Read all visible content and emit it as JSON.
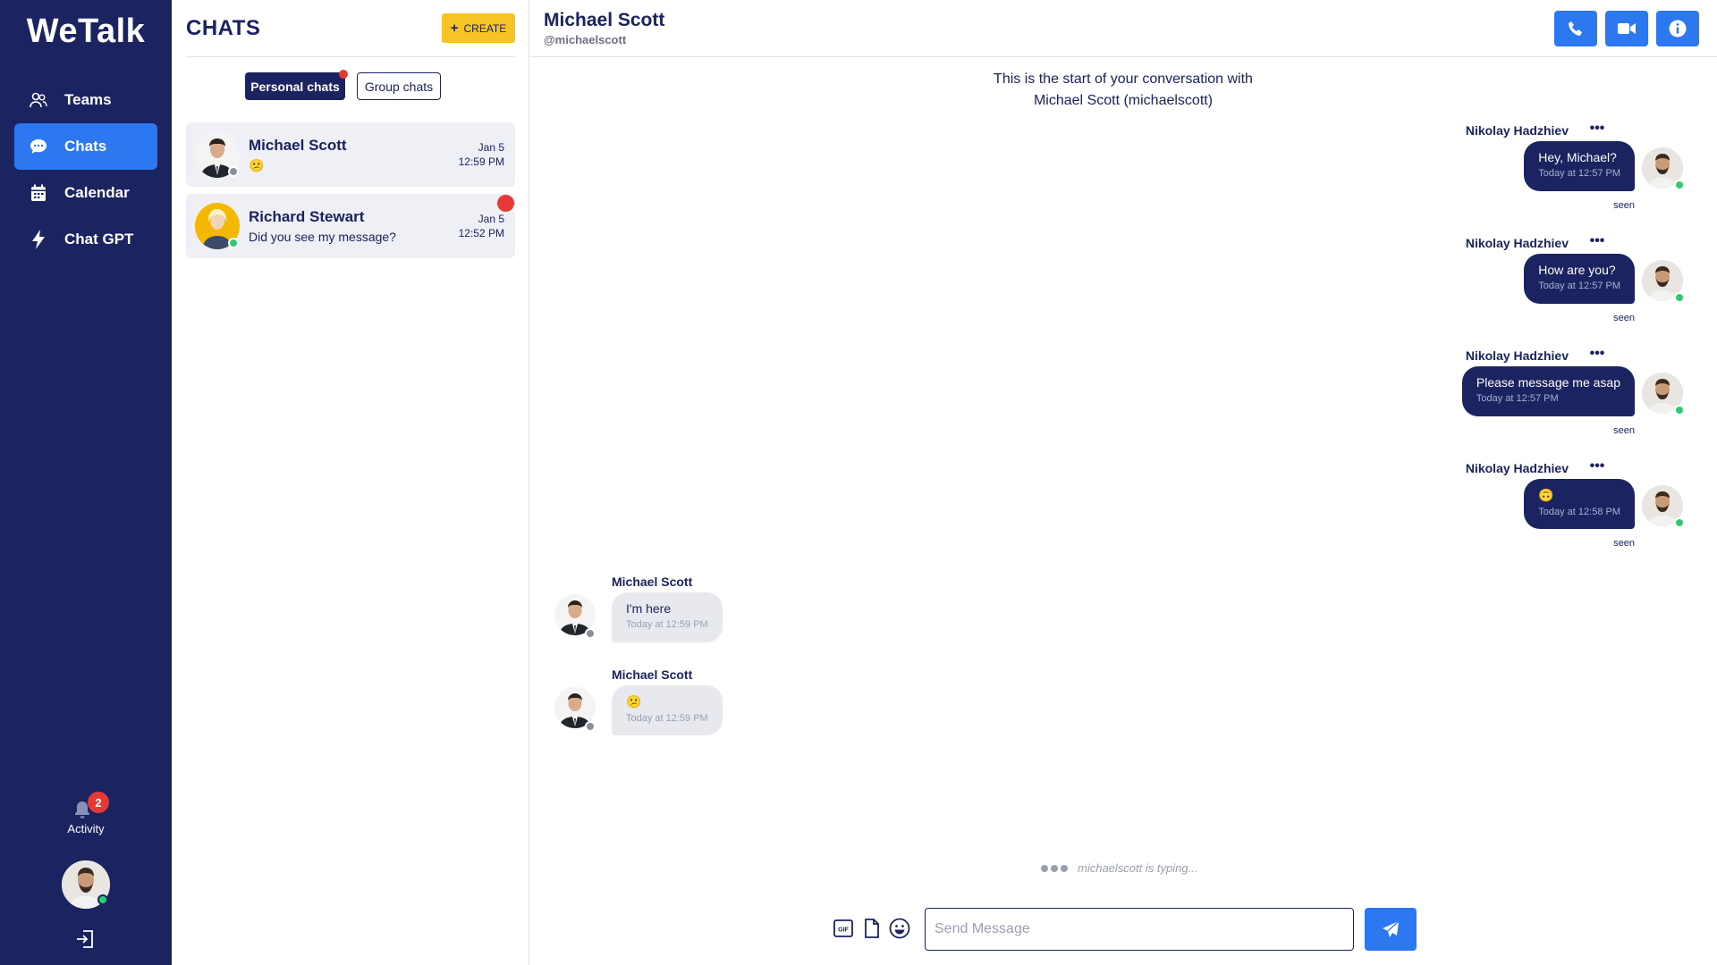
{
  "app": {
    "name": "WeTalk"
  },
  "sidebar": {
    "items": [
      {
        "label": "Teams",
        "icon": "users-icon",
        "active": false
      },
      {
        "label": "Chats",
        "icon": "chat-bubble-icon",
        "active": true
      },
      {
        "label": "Calendar",
        "icon": "calendar-icon",
        "active": false
      },
      {
        "label": "Chat GPT",
        "icon": "bolt-icon",
        "active": false
      }
    ],
    "activity": {
      "label": "Activity",
      "count": "2"
    }
  },
  "chats_panel": {
    "title": "CHATS",
    "create_label": "CREATE",
    "tabs": {
      "personal": "Personal chats",
      "group": "Group chats"
    },
    "chats": [
      {
        "name": "Michael Scott",
        "preview": "😕",
        "date": "Jan 5",
        "time": "12:59 PM",
        "online": false,
        "unread": false
      },
      {
        "name": "Richard Stewart",
        "preview": "Did you see my message?",
        "date": "Jan 5",
        "time": "12:52 PM",
        "online": true,
        "unread": true
      }
    ]
  },
  "conversation": {
    "name": "Michael Scott",
    "handle": "@michaelscott",
    "start_line1": "This is the start of your conversation with",
    "start_line2": "Michael Scott (michaelscott)",
    "messages_out": [
      {
        "sender": "Nikolay Hadzhiev",
        "text": "Hey, Michael?",
        "time": "Today at 12:57 PM",
        "seen": "seen"
      },
      {
        "sender": "Nikolay Hadzhiev",
        "text": "How are you?",
        "time": "Today at 12:57 PM",
        "seen": "seen"
      },
      {
        "sender": "Nikolay Hadzhiev",
        "text": "Please message me asap",
        "time": "Today at 12:57 PM",
        "seen": "seen"
      },
      {
        "sender": "Nikolay Hadzhiev",
        "text": "🙃",
        "time": "Today at 12:58 PM",
        "seen": "seen"
      }
    ],
    "messages_in": [
      {
        "sender": "Michael Scott",
        "text": "I'm here",
        "time": "Today at 12:59 PM"
      },
      {
        "sender": "Michael Scott",
        "text": "😕",
        "time": "Today at 12:59 PM"
      }
    ],
    "typing": "michaelscott is typing...",
    "composer": {
      "placeholder": "Send Message"
    }
  },
  "colors": {
    "sidebar": "#1b2361",
    "accent": "#2b78f0",
    "create": "#f7c325",
    "online": "#2ecc71",
    "offline": "#8a8f9c",
    "unread": "#e53935"
  }
}
